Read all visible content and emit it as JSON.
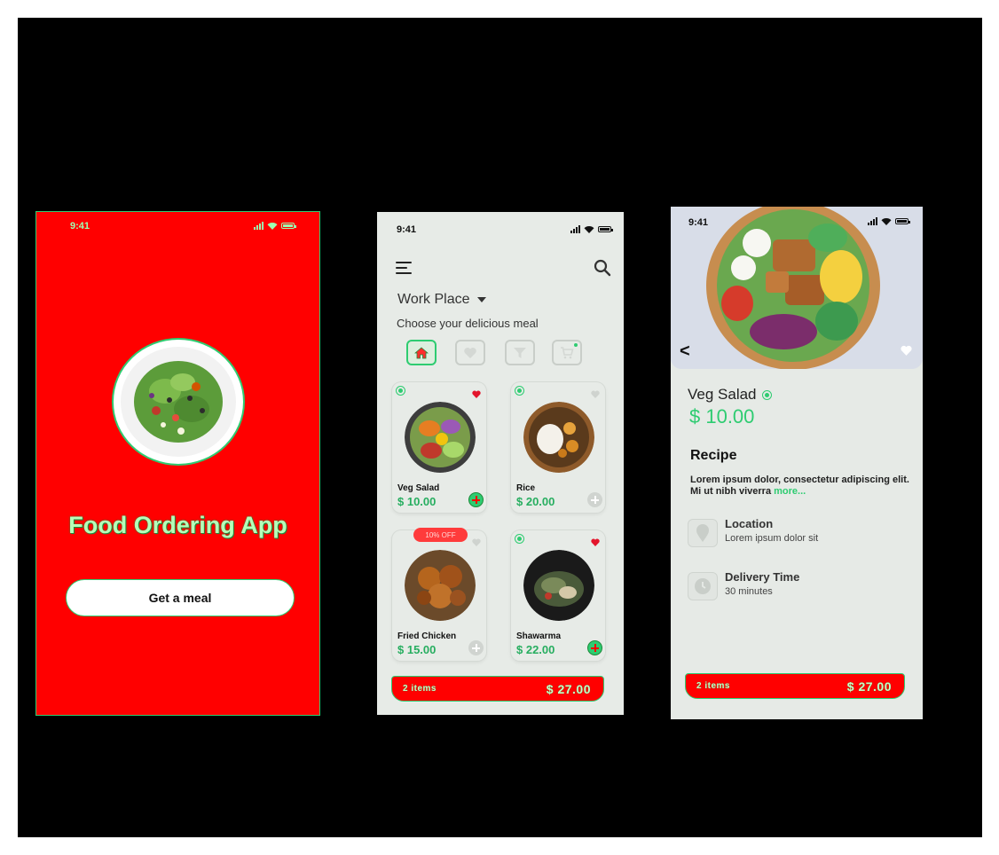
{
  "status": {
    "time": "9:41"
  },
  "splash": {
    "title": "Food Ordering App",
    "cta_label": "Get a meal"
  },
  "menu": {
    "location": "Work Place",
    "subtitle": "Choose your delicious meal",
    "categories": [
      "home-icon",
      "heart-icon",
      "filter-icon",
      "cart-icon"
    ],
    "items": [
      {
        "name": "Veg Salad",
        "price": "$ 10.00",
        "favorite": true,
        "in_cart": true
      },
      {
        "name": "Rice",
        "price": "$ 20.00",
        "favorite": false,
        "in_cart": false
      },
      {
        "name": "Fried Chicken",
        "price": "$ 15.00",
        "favorite": false,
        "in_cart": false,
        "badge": "10% OFF"
      },
      {
        "name": "Shawarma",
        "price": "$ 22.00",
        "favorite": true,
        "in_cart": true
      }
    ],
    "cart": {
      "items_label": "2 items",
      "total": "$ 27.00"
    }
  },
  "detail": {
    "title": "Veg Salad",
    "price": "$ 10.00",
    "recipe_heading": "Recipe",
    "recipe_text": "Lorem ipsum dolor, consectetur adipiscing elit. Mi ut nibh viverra ",
    "recipe_more": "more...",
    "location_title": "Location",
    "location_text": "Lorem ipsum dolor sit",
    "delivery_title": "Delivery Time",
    "delivery_text": "30 minutes",
    "cart": {
      "items_label": "2 items",
      "total": "$ 27.00"
    }
  },
  "colors": {
    "accent_green": "#2ecc71",
    "splash_red": "#ff0000",
    "screen_bg": "#e7ebe7"
  }
}
